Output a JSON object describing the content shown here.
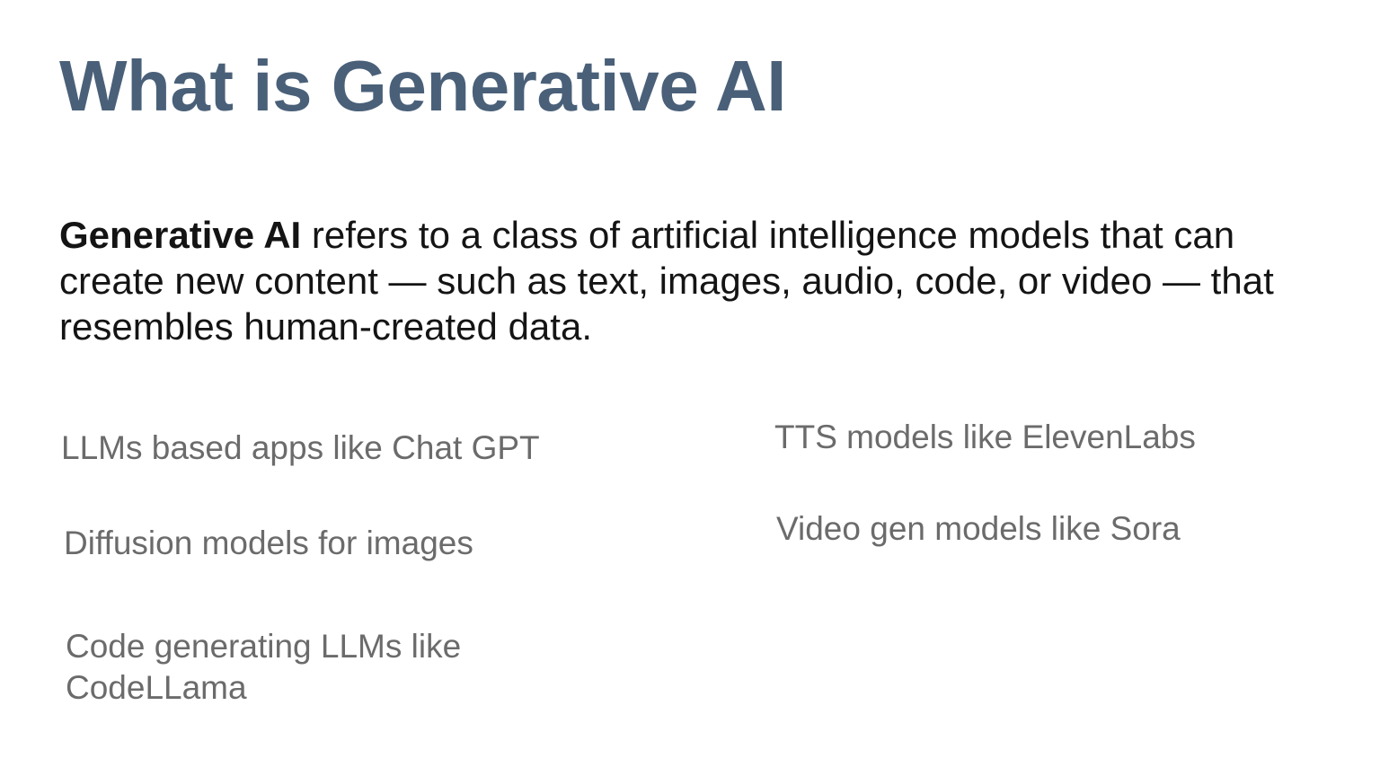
{
  "slide": {
    "title": "What is Generative AI",
    "definition": {
      "term": "Generative AI",
      "text": " refers to a class of artificial intelligence models that can create new content — such as text, images, audio, code, or video — that resembles human-created data."
    },
    "examples": {
      "left": [
        "LLMs based apps like Chat GPT",
        "Diffusion models for images",
        "Code generating LLMs like CodeLLama"
      ],
      "right": [
        "TTS models like ElevenLabs",
        "Video gen models like Sora"
      ]
    }
  },
  "colors": {
    "title": "#4a6079",
    "body_text": "#141414",
    "example_text": "#6b6b6b",
    "background": "#ffffff"
  }
}
